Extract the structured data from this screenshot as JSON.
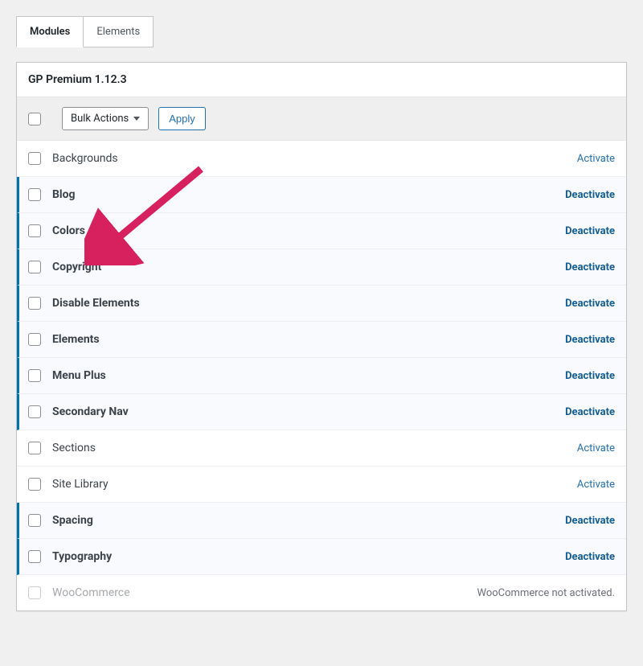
{
  "tabs": {
    "modules": "Modules",
    "elements": "Elements"
  },
  "panel": {
    "title": "GP Premium 1.12.3"
  },
  "bulk": {
    "select_label": "Bulk Actions",
    "apply_label": "Apply"
  },
  "modules": [
    {
      "name": "Backgrounds",
      "active": false,
      "action_label": "Activate"
    },
    {
      "name": "Blog",
      "active": true,
      "action_label": "Deactivate"
    },
    {
      "name": "Colors",
      "active": true,
      "action_label": "Deactivate"
    },
    {
      "name": "Copyright",
      "active": true,
      "action_label": "Deactivate"
    },
    {
      "name": "Disable Elements",
      "active": true,
      "action_label": "Deactivate"
    },
    {
      "name": "Elements",
      "active": true,
      "action_label": "Deactivate"
    },
    {
      "name": "Menu Plus",
      "active": true,
      "action_label": "Deactivate"
    },
    {
      "name": "Secondary Nav",
      "active": true,
      "action_label": "Deactivate"
    },
    {
      "name": "Sections",
      "active": false,
      "action_label": "Activate"
    },
    {
      "name": "Site Library",
      "active": false,
      "action_label": "Activate"
    },
    {
      "name": "Spacing",
      "active": true,
      "action_label": "Deactivate"
    },
    {
      "name": "Typography",
      "active": true,
      "action_label": "Deactivate"
    },
    {
      "name": "WooCommerce",
      "active": false,
      "disabled": true,
      "note": "WooCommerce not activated."
    }
  ],
  "arrow": {
    "color": "#d6215e"
  }
}
